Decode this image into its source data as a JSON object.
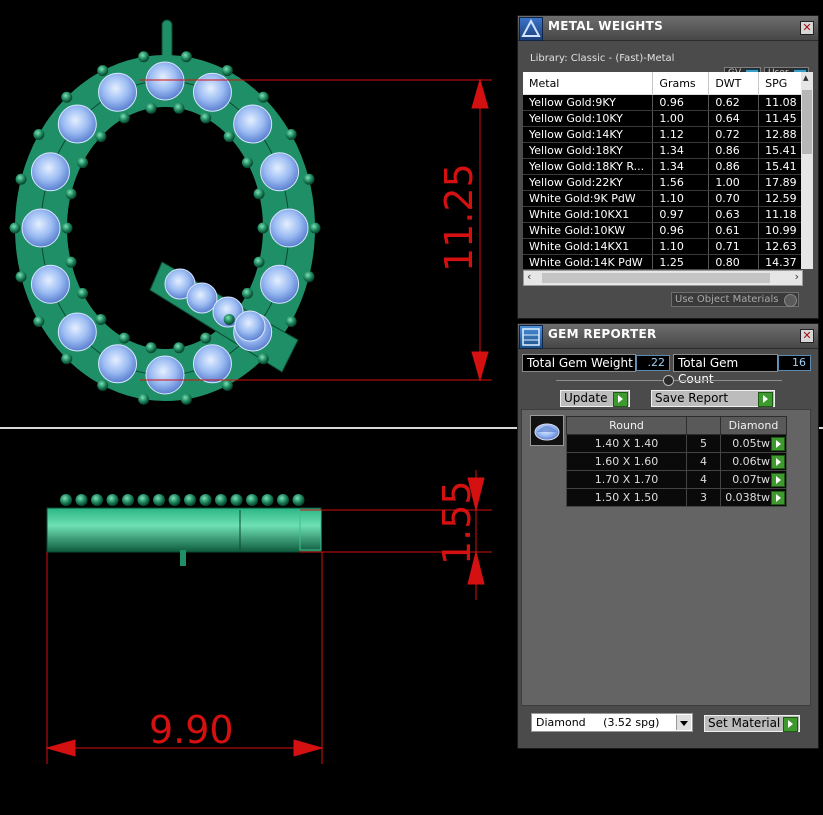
{
  "viewport": {
    "dimensions": {
      "height_top": "11.25",
      "height_bottom": "1.55",
      "width_bottom": "9.90"
    },
    "colors": {
      "dimension": "#d41010",
      "metal": "#1f8f68",
      "gem": "#8fb6f0"
    }
  },
  "metal_weights": {
    "title": "METAL WEIGHTS",
    "library": "Library: Classic - (Fast)-Metal",
    "toggle_gv": "GV",
    "toggle_user": "User",
    "columns": [
      "Metal",
      "Grams",
      "DWT",
      "SPG"
    ],
    "rows": [
      [
        "Yellow Gold:9KY",
        "0.96",
        "0.62",
        "11.08"
      ],
      [
        "Yellow Gold:10KY",
        "1.00",
        "0.64",
        "11.45"
      ],
      [
        "Yellow Gold:14KY",
        "1.12",
        "0.72",
        "12.88"
      ],
      [
        "Yellow Gold:18KY",
        "1.34",
        "0.86",
        "15.41"
      ],
      [
        "Yellow Gold:18KY R...",
        "1.34",
        "0.86",
        "15.41"
      ],
      [
        "Yellow Gold:22KY",
        "1.56",
        "1.00",
        "17.89"
      ],
      [
        "White Gold:9K PdW",
        "1.10",
        "0.70",
        "12.59"
      ],
      [
        "White Gold:10KX1",
        "0.97",
        "0.63",
        "11.18"
      ],
      [
        "White Gold:10KW",
        "0.96",
        "0.61",
        "10.99"
      ],
      [
        "White Gold:14KX1",
        "1.10",
        "0.71",
        "12.63"
      ],
      [
        "White Gold:14K PdW",
        "1.25",
        "0.80",
        "14.37"
      ]
    ],
    "use_object_materials": "Use Object Materials"
  },
  "gem_reporter": {
    "title": "GEM REPORTER",
    "total_weight_label": "Total Gem Weight",
    "total_weight_value": ".22",
    "total_count_label": "Total Gem Count",
    "total_count_value": "16",
    "update_label": "Update",
    "save_report_label": "Save Report",
    "table_headers": [
      "Round",
      "",
      "Diamond"
    ],
    "rows": [
      [
        "1.40 X 1.40",
        "5",
        "0.05tw"
      ],
      [
        "1.60 X 1.60",
        "4",
        "0.06tw"
      ],
      [
        "1.70 X 1.70",
        "4",
        "0.07tw"
      ],
      [
        "1.50 X 1.50",
        "3",
        "0.038tw"
      ]
    ],
    "material_select": "Diamond     (3.52 spg)",
    "set_material_label": "Set Material"
  }
}
